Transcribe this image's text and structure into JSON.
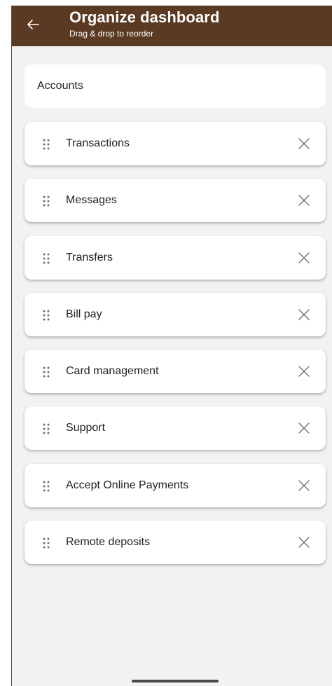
{
  "header": {
    "title": "Organize dashboard",
    "subtitle": "Drag & drop to reorder",
    "back_icon": "arrow-left-icon",
    "background_color": "#5a3a22"
  },
  "fixed_card": {
    "label": "Accounts"
  },
  "items": [
    {
      "label": "Transactions"
    },
    {
      "label": "Messages"
    },
    {
      "label": "Transfers"
    },
    {
      "label": "Bill pay"
    },
    {
      "label": "Card management"
    },
    {
      "label": "Support"
    },
    {
      "label": "Accept Online Payments"
    },
    {
      "label": "Remote deposits"
    }
  ],
  "icons": {
    "drag": "drag-handle-icon",
    "remove": "close-icon"
  }
}
